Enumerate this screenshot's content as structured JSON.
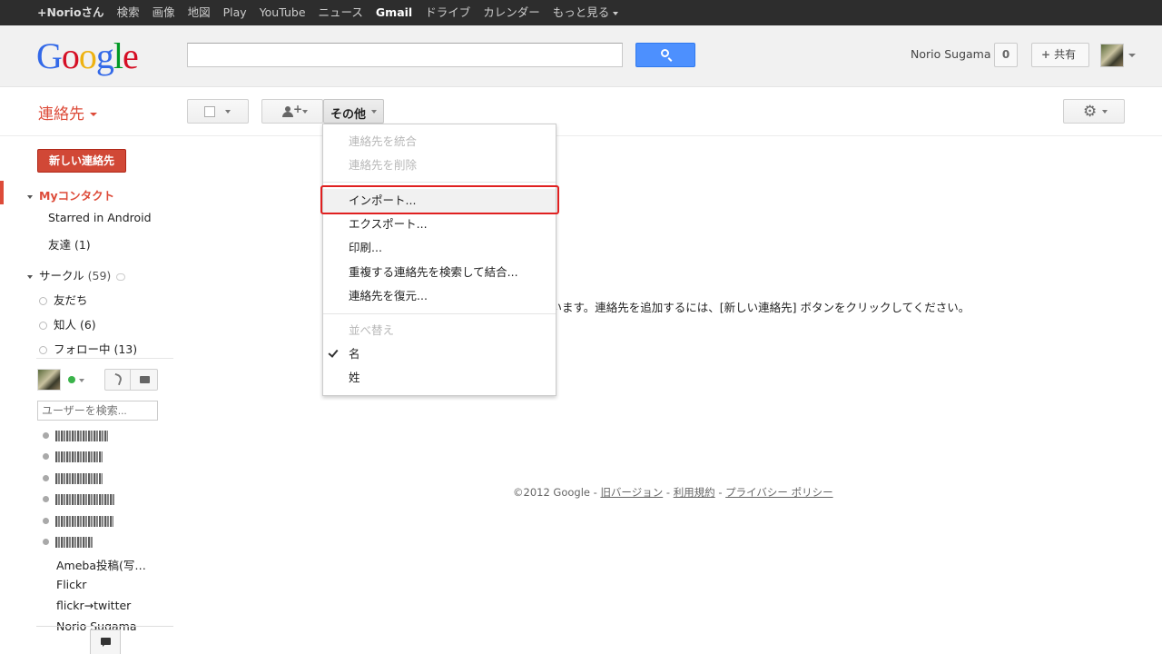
{
  "topbar": {
    "items": [
      "+Norioさん",
      "検索",
      "画像",
      "地図",
      "Play",
      "YouTube",
      "ニュース",
      "Gmail",
      "ドライブ",
      "カレンダー",
      "もっと見る"
    ]
  },
  "header": {
    "search_placeholder": "",
    "user_name": "Norio Sugama",
    "notification_count": "0",
    "share_label": "共有"
  },
  "app": {
    "title": "連絡先",
    "more_label": "その他",
    "new_contact_label": "新しい連絡先"
  },
  "sidebar": {
    "my_contacts": "Myコンタクト",
    "starred": "Starred in Android",
    "friends": "友達 (1)",
    "circles_label": "サークル",
    "circles_count": "(59)",
    "circles": [
      "友だち",
      "知人 (6)",
      "フォロー中 (13)"
    ]
  },
  "chat": {
    "search_placeholder": "ユーザーを検索...",
    "plain_contacts": [
      "Ameba投稿(写…",
      "Flickr",
      "flickr→twitter",
      "Norio Sugama"
    ]
  },
  "main": {
    "empty_message": "ざいます。連絡先を追加するには、[新しい連絡先] ボタンをクリックしてください。",
    "footer_copyright": "©2012 Google - ",
    "footer_links": [
      "旧バージョン",
      "利用規約",
      "プライバシー ポリシー"
    ],
    "footer_sep": " - "
  },
  "menu": {
    "merge": "連絡先を統合",
    "delete": "連絡先を削除",
    "import": "インポート...",
    "export": "エクスポート...",
    "print": "印刷...",
    "dedupe": "重複する連絡先を検索して結合...",
    "restore": "連絡先を復元...",
    "sort_label": "並べ替え",
    "sort_first": "名",
    "sort_last": "姓"
  },
  "colors": {
    "accent_red": "#dd4b39",
    "search_blue": "#4d90fe",
    "highlight_red": "#e02020"
  }
}
